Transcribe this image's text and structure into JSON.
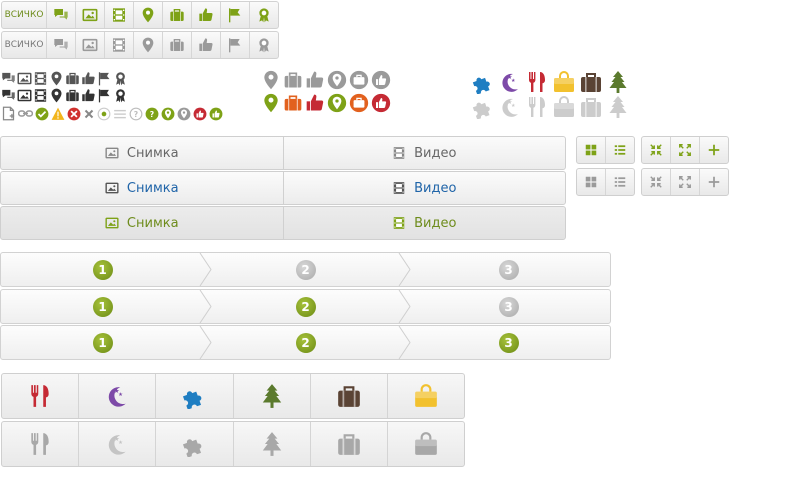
{
  "colors": {
    "green": "#7ea217",
    "gray": "#9a9a9a",
    "dark": "#555555",
    "orange": "#e2611e",
    "red": "#c52a34",
    "blue": "#1f7ec2",
    "purple": "#7d4aa8",
    "yellow": "#f2c12e",
    "brown": "#5a4334",
    "tree": "#5b7a2d",
    "link": "#1f64a8"
  },
  "filter_bars": [
    {
      "label": "ВСИЧКО",
      "icons": [
        "comments-icon",
        "image-icon",
        "film-icon",
        "map-pin-icon",
        "briefcase-icon",
        "thumbs-up-icon",
        "flag-icon",
        "award-icon"
      ]
    },
    {
      "label": "ВСИЧКО",
      "icons": [
        "comments-icon",
        "image-icon",
        "film-icon",
        "map-pin-icon",
        "briefcase-icon",
        "thumbs-up-icon",
        "flag-icon",
        "award-icon"
      ]
    }
  ],
  "tabs": [
    {
      "photo_label": "Снимка",
      "video_label": "Видео",
      "state": "default"
    },
    {
      "photo_label": "Снимка",
      "video_label": "Видео",
      "state": "hover"
    },
    {
      "photo_label": "Снимка",
      "video_label": "Видео",
      "state": "active"
    }
  ],
  "view_toggles": {
    "view_icons": [
      "grid-view-icon",
      "list-view-icon"
    ],
    "action_icons": [
      "collapse-icon",
      "expand-icon",
      "add-icon"
    ]
  },
  "steps": [
    {
      "numbers": [
        "1",
        "2",
        "3"
      ],
      "active_count": 1
    },
    {
      "numbers": [
        "1",
        "2",
        "3"
      ],
      "active_count": 2
    },
    {
      "numbers": [
        "1",
        "2",
        "3"
      ],
      "active_count": 3
    }
  ],
  "categories": [
    "food-icon",
    "night-icon",
    "puzzle-icon",
    "tree-icon",
    "suitcase-icon",
    "shopping-bag-icon"
  ]
}
